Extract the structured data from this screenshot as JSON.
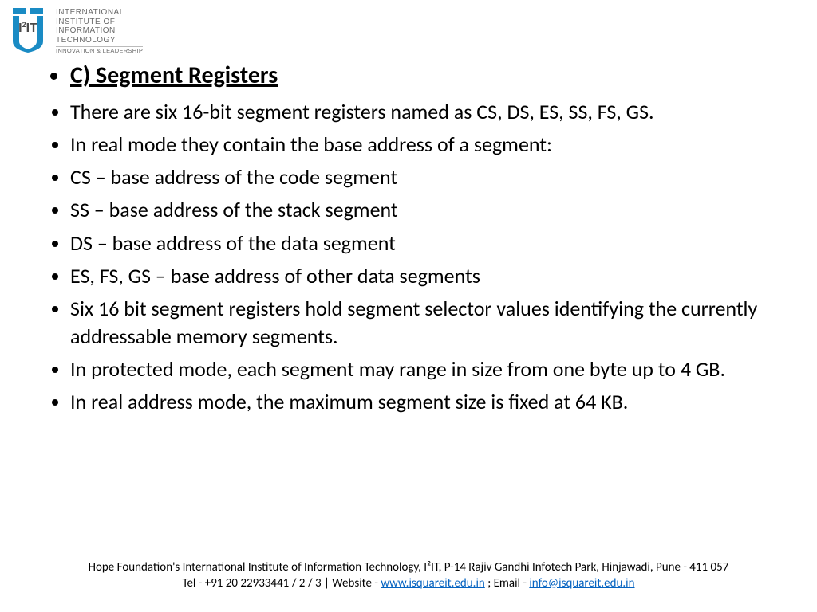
{
  "org": {
    "line1": "INTERNATIONAL",
    "line2": "INSTITUTE OF",
    "line3": "INFORMATION",
    "line4": "TECHNOLOGY",
    "tagline": "INNOVATION & LEADERSHIP",
    "logo_text": "I²IT"
  },
  "slide": {
    "title": "C) Segment Registers",
    "bullets": [
      "There are six 16-bit segment registers named as CS, DS, ES, SS, FS, GS.",
      "In real mode they contain the base address of a segment:",
      "CS – base address of the code segment",
      "SS – base address of the stack segment",
      "DS – base address of the data segment",
      "ES, FS, GS – base address of other data segments",
      "Six 16 bit segment registers hold segment selector values identifying the currently addressable memory segments.",
      "In protected mode, each segment may range in size from one byte up to 4 GB.",
      "In real address mode, the maximum segment size is fixed at 64 KB."
    ]
  },
  "footer": {
    "line1": "Hope Foundation's International Institute of Information Technology, I²IT, P-14 Rajiv Gandhi Infotech Park, Hinjawadi, Pune - 411 057",
    "tel_prefix": "Tel - +91 20 22933441 / 2 / 3   |   Website - ",
    "website": "www.isquareit.edu.in",
    "email_prefix": " ; Email - ",
    "email": "info@isquareit.edu.in"
  }
}
